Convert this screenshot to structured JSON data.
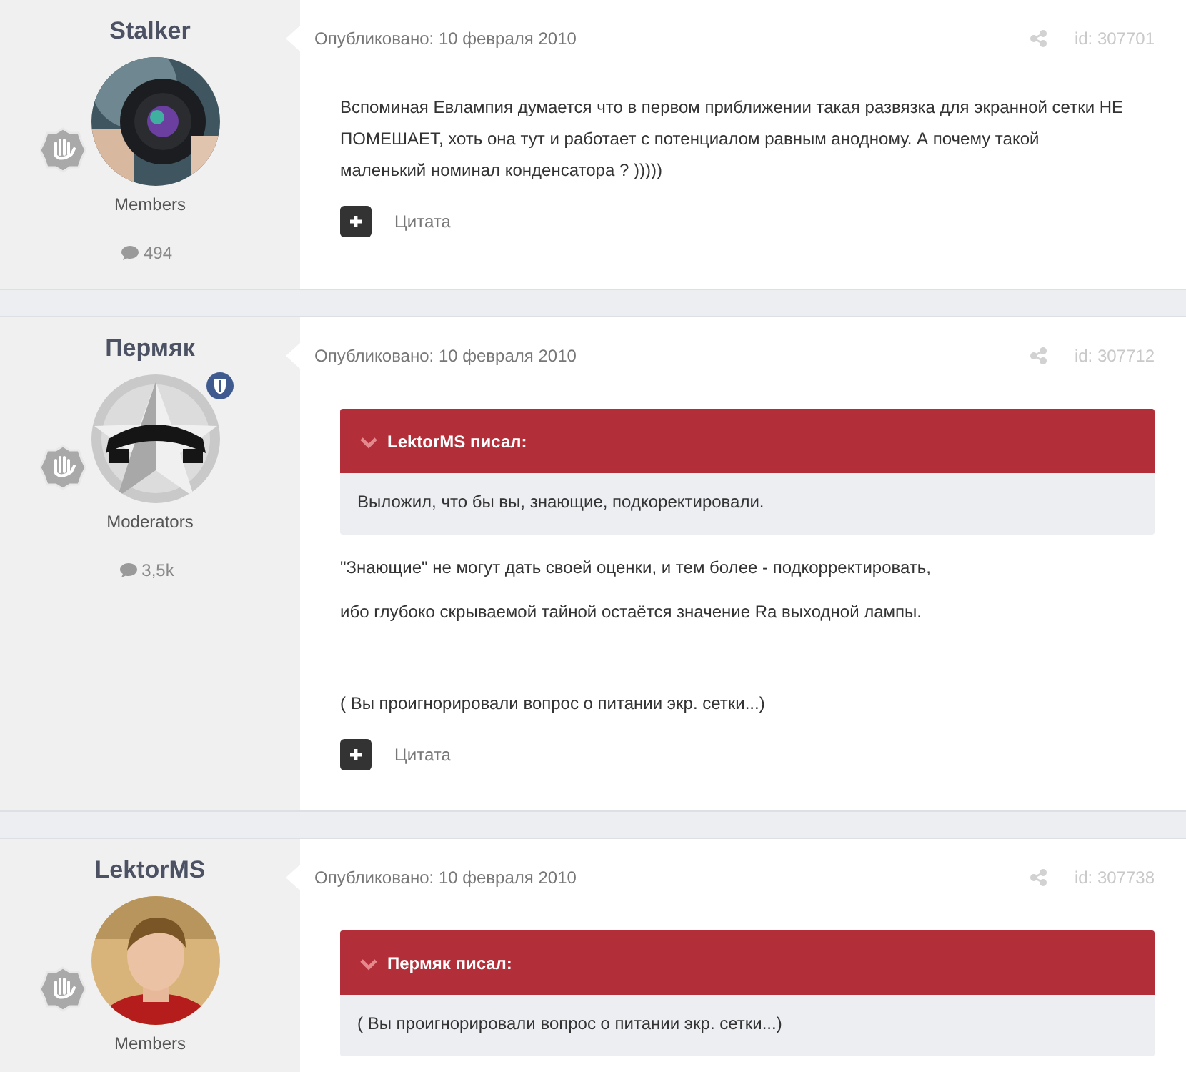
{
  "posts": [
    {
      "author": "Stalker",
      "avatar": {
        "kind": "picture"
      },
      "moderator": false,
      "group": "Members",
      "post_count": "494",
      "date": "Опубликовано: 10 февраля 2010",
      "id": "id: 307701",
      "text_blocks": [
        {
          "lines": [
            "Вспоминая Евлампия думается что в первом приближении такая развязка для экранной сетки НЕ ПОМЕШАЕТ, хоть она тут и работает с потенциалом равным анодному. А почему такой маленький номинал конденсатора ? )))))"
          ]
        }
      ],
      "quote_button": "Цитата"
    },
    {
      "author": "Пермяк",
      "avatar": {
        "kind": "picture"
      },
      "moderator": true,
      "group": "Moderators",
      "post_count": "3,5k",
      "date": "Опубликовано: 10 февраля 2010",
      "id": "id: 307712",
      "quote": {
        "title": "LektorMS писал:",
        "text": "Выложил, что бы вы, знающие, подкоректировали."
      },
      "text_blocks": [
        {
          "lines": [
            "\"Знающие\" не могут дать своей оценки, и тем более - подкорректировать,",
            "ибо глубоко скрываемой тайной остаётся значение Ra выходной лампы."
          ]
        },
        {
          "lines": [
            "( Вы проигнорировали вопрос о питании экр. сетки...)"
          ]
        }
      ],
      "quote_button": "Цитата"
    },
    {
      "author": "LektorMS",
      "avatar": {
        "kind": "picture"
      },
      "moderator": false,
      "group": "Members",
      "date": "Опубликовано: 10 февраля 2010",
      "id": "id: 307738",
      "quote": {
        "title": "Пермяк писал:",
        "text": "( Вы проигнорировали вопрос о питании экр. сетки...)"
      }
    }
  ]
}
